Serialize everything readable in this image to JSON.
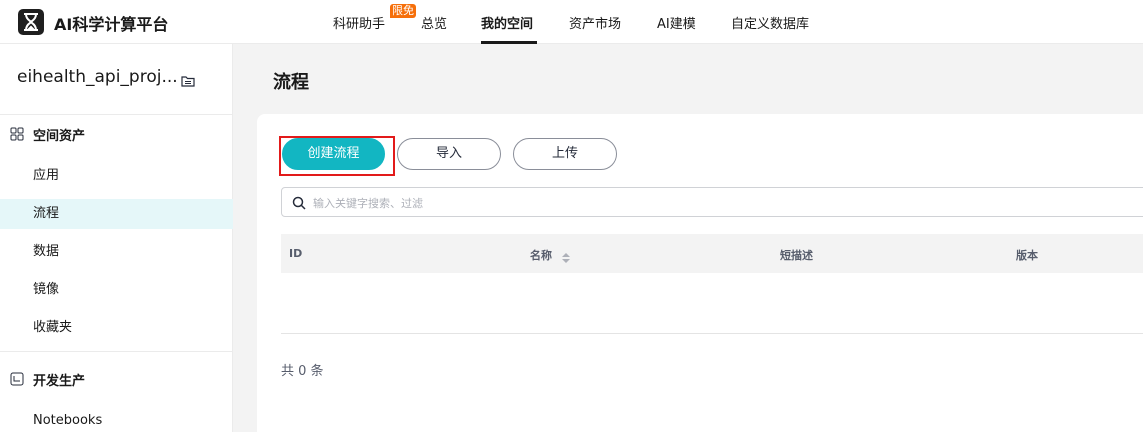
{
  "header": {
    "app_title": "AI科学计算平台",
    "nav": [
      "科研助手",
      "总览",
      "我的空间",
      "资产市场",
      "AI建模",
      "自定义数据库"
    ],
    "badge": "限免",
    "active_nav": "我的空间"
  },
  "sidebar": {
    "project_name": "eihealth_api_proj...",
    "group1": "空间资产",
    "items": [
      "应用",
      "流程",
      "数据",
      "镜像",
      "收藏夹"
    ],
    "active_item": "流程",
    "group2": "开发生产",
    "group2_items": [
      "Notebooks"
    ]
  },
  "main": {
    "title": "流程",
    "buttons": {
      "create": "创建流程",
      "import": "导入",
      "upload": "上传"
    },
    "search": {
      "placeholder": "输入关键字搜索、过滤"
    },
    "table": {
      "columns": [
        "ID",
        "名称",
        "短描述",
        "版本"
      ]
    },
    "total": "共 0 条"
  },
  "colors": {
    "accent": "#12b6c2",
    "highlight": "#e21a1a",
    "badge": "#f66f0a"
  }
}
